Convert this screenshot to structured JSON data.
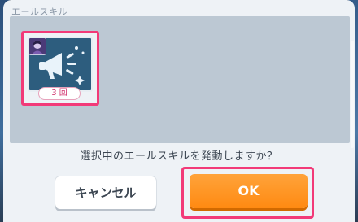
{
  "section": {
    "title": "エールスキル"
  },
  "skill": {
    "count_label": "3 回",
    "icon": "megaphone-icon",
    "avatar": "character-avatar"
  },
  "dialog": {
    "question": "選択中のエールスキルを発動しますか？"
  },
  "buttons": {
    "cancel_label": "キャンセル",
    "ok_label": "OK"
  },
  "colors": {
    "highlight": "#f23a78",
    "ok_button": "#ff8a12",
    "skill_area": "#bcc8d3",
    "icon_background": "#2d5d7e"
  }
}
